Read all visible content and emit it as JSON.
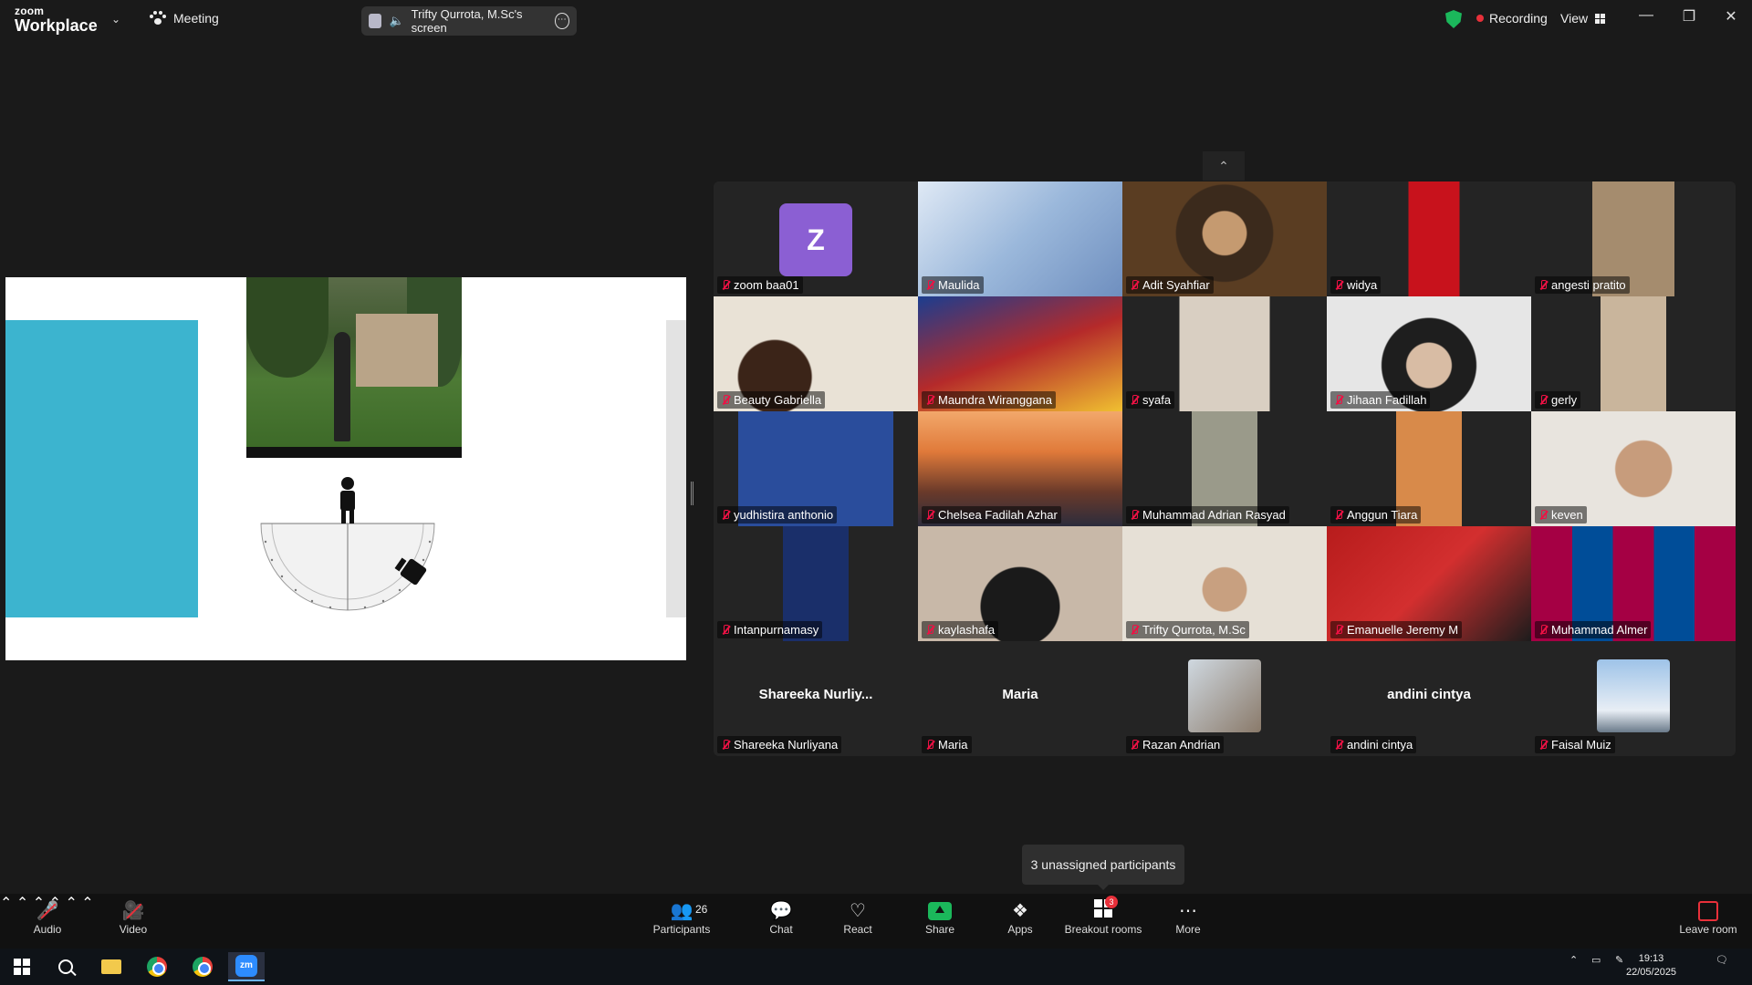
{
  "titlebar": {
    "logo_top": "zoom",
    "logo_bottom": "Workplace",
    "meeting_label": "Meeting",
    "share_label": "Trifty Qurrota, M.Sc's screen",
    "recording_label": "Recording",
    "view_label": "View",
    "colors": {
      "recording_dot": "#e8303a",
      "security": "#1bb85b"
    }
  },
  "gallery": {
    "tiles": [
      {
        "name": "zoom baa01",
        "type": "letter",
        "letter": "Z"
      },
      {
        "name": "Maulida",
        "type": "video"
      },
      {
        "name": "Adit Syahfiar",
        "type": "video"
      },
      {
        "name": "widya",
        "type": "video"
      },
      {
        "name": "angesti pratito",
        "type": "video"
      },
      {
        "name": "Beauty Gabriella",
        "type": "video"
      },
      {
        "name": "Maundra Wiranggana",
        "type": "video"
      },
      {
        "name": "syafa",
        "type": "video"
      },
      {
        "name": "Jihaan Fadillah",
        "type": "video"
      },
      {
        "name": "gerly",
        "type": "video"
      },
      {
        "name": "yudhistira anthonio",
        "type": "video"
      },
      {
        "name": "Chelsea Fadilah Azhar",
        "type": "video"
      },
      {
        "name": "Muhammad Adrian Rasyad",
        "type": "video"
      },
      {
        "name": "Anggun Tiara",
        "type": "video"
      },
      {
        "name": "keven",
        "type": "video"
      },
      {
        "name": "Intanpurnamasy",
        "type": "video"
      },
      {
        "name": "kaylashafa",
        "type": "video"
      },
      {
        "name": "Trifty Qurrota, M.Sc",
        "type": "video",
        "active": true
      },
      {
        "name": "Emanuelle Jeremy M",
        "type": "video"
      },
      {
        "name": "Muhammad Almer",
        "type": "video"
      },
      {
        "name": "Shareeka Nurliyana",
        "type": "text",
        "display": "Shareeka  Nurliy..."
      },
      {
        "name": "Maria",
        "type": "text",
        "display": "Maria"
      },
      {
        "name": "Razan Andrian",
        "type": "thumb"
      },
      {
        "name": "andini cintya",
        "type": "text",
        "display": "andini cintya"
      },
      {
        "name": "Faisal Muiz",
        "type": "thumb"
      }
    ]
  },
  "tooltip": "3 unassigned participants",
  "toolbar": {
    "audio": "Audio",
    "video": "Video",
    "participants": "Participants",
    "participants_count": "26",
    "chat": "Chat",
    "react": "React",
    "share": "Share",
    "apps": "Apps",
    "breakout": "Breakout rooms",
    "breakout_badge": "3",
    "more": "More",
    "leave": "Leave room"
  },
  "taskbar": {
    "time": "19:13",
    "date": "22/05/2025",
    "zoom_icon_text": "zm"
  }
}
